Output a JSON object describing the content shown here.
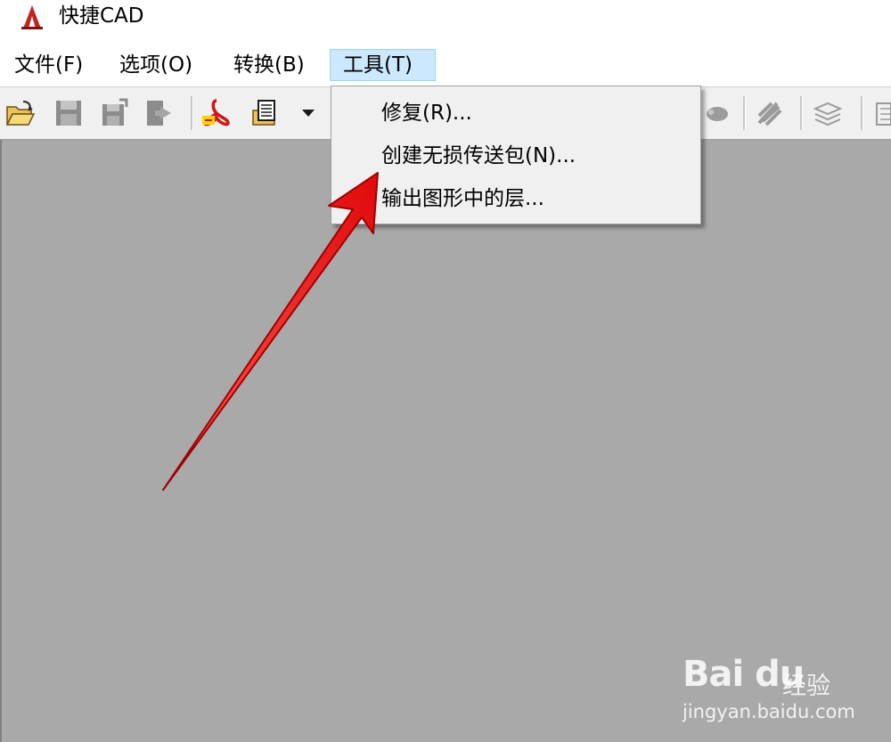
{
  "app": {
    "title": "快捷CAD",
    "icon": "app-logo-icon"
  },
  "menubar": {
    "items": [
      {
        "label": "文件(F)"
      },
      {
        "label": "选项(O)"
      },
      {
        "label": "转换(B)"
      },
      {
        "label": "工具(T)",
        "active": true
      }
    ]
  },
  "toolbar": {
    "icons": [
      "open-folder-icon",
      "save-icon",
      "save-as-icon",
      "export-icon",
      "pdf-convert-icon",
      "batch-convert-icon",
      "dropdown-arrow-icon",
      "tool-icon",
      "settings-icon",
      "layers-icon",
      "panel-icon"
    ]
  },
  "tools_menu": {
    "items": [
      {
        "label": "修复(R)..."
      },
      {
        "label": "创建无损传送包(N)..."
      },
      {
        "label": "输出图形中的层..."
      }
    ]
  },
  "watermark": {
    "logo": "Bai du",
    "brand": "经验",
    "url": "jingyan.baidu.com"
  },
  "colors": {
    "workspace": "#a9a9a9",
    "menu_active": "#cce8ff",
    "dropdown_bg": "#f0f0f0",
    "arrow": "#e81010"
  }
}
